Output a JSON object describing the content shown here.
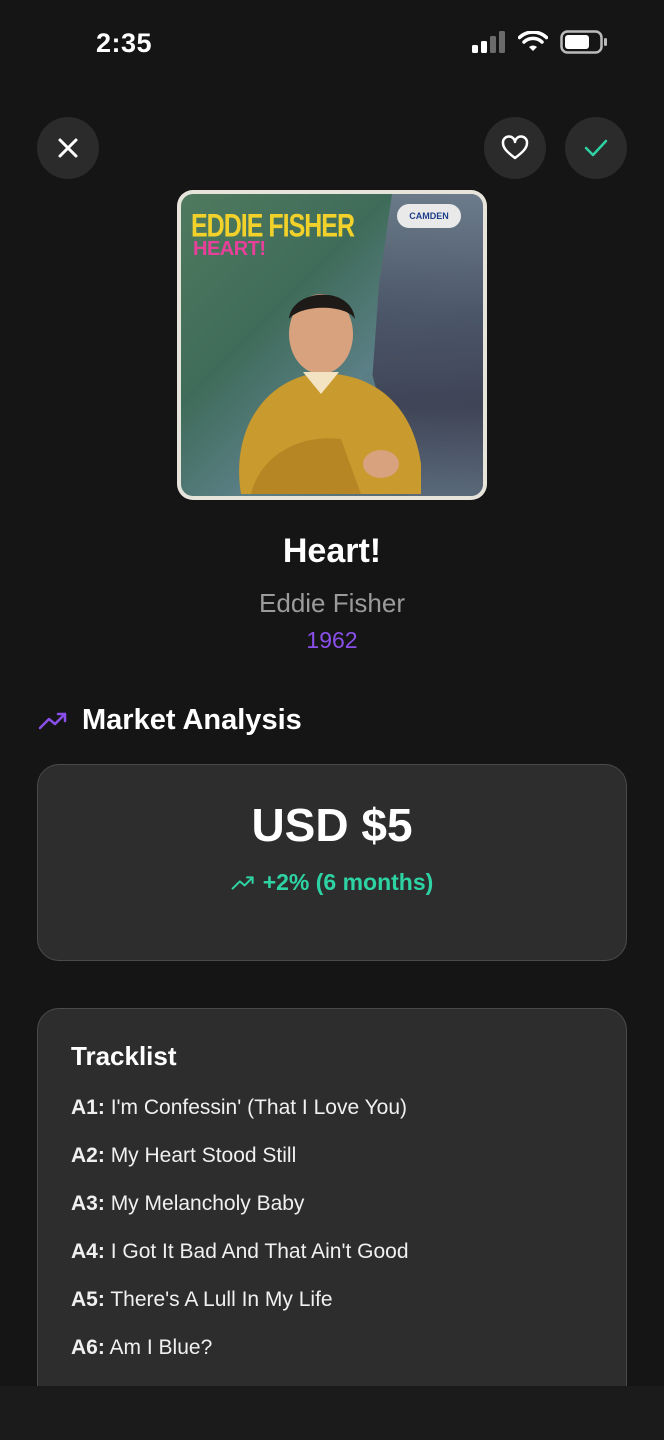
{
  "status_bar": {
    "time": "2:35"
  },
  "album": {
    "cover_artist_text": "EDDIE FISHER",
    "cover_title_text": "HEART!",
    "cover_label_text": "CAMDEN",
    "title": "Heart!",
    "artist": "Eddie Fisher",
    "year": "1962"
  },
  "market": {
    "section_label": "Market Analysis",
    "price": "USD $5",
    "change": "+2% (6 months)"
  },
  "tracklist": {
    "header": "Tracklist",
    "tracks": [
      {
        "pos": "A1:",
        "name": "I'm Confessin' (That I Love You)"
      },
      {
        "pos": "A2:",
        "name": "My Heart Stood Still"
      },
      {
        "pos": "A3:",
        "name": "My Melancholy Baby"
      },
      {
        "pos": "A4:",
        "name": "I Got It Bad And That Ain't Good"
      },
      {
        "pos": "A5:",
        "name": "There's A Lull In My Life"
      },
      {
        "pos": "A6:",
        "name": "Am I Blue?"
      }
    ]
  },
  "colors": {
    "accent_purple": "#8a4fea",
    "accent_teal": "#2ed3a4",
    "background": "#151515",
    "card": "#2d2d2d"
  },
  "icons": [
    "close-icon",
    "heart-icon",
    "check-icon",
    "trending-up-icon",
    "signal-icon",
    "wifi-icon",
    "battery-icon"
  ]
}
